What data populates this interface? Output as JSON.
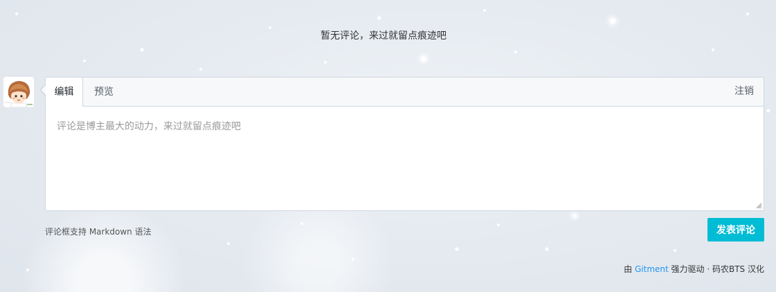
{
  "comments": {
    "empty_message": "暂无评论，来过就留点痕迹吧"
  },
  "editor": {
    "tabs": [
      {
        "label": "编辑",
        "active": true
      },
      {
        "label": "预览",
        "active": false
      }
    ],
    "logout_label": "注销",
    "textarea_placeholder": "评论是博主最大的动力，来过就留点痕迹吧",
    "textarea_value": ""
  },
  "markdown_tip": "评论框支持 Markdown 语法",
  "submit_label": "发表评论",
  "footer": {
    "prefix": "由",
    "link_text": "Gitment",
    "suffix": "强力驱动 · 码农BTS 汉化"
  },
  "colors": {
    "accent": "#00bcd4",
    "link": "#2196f3",
    "border": "#cfd6de"
  },
  "icons": {
    "avatar": "user-avatar-cartoon",
    "resize": "resize-handle-icon"
  }
}
